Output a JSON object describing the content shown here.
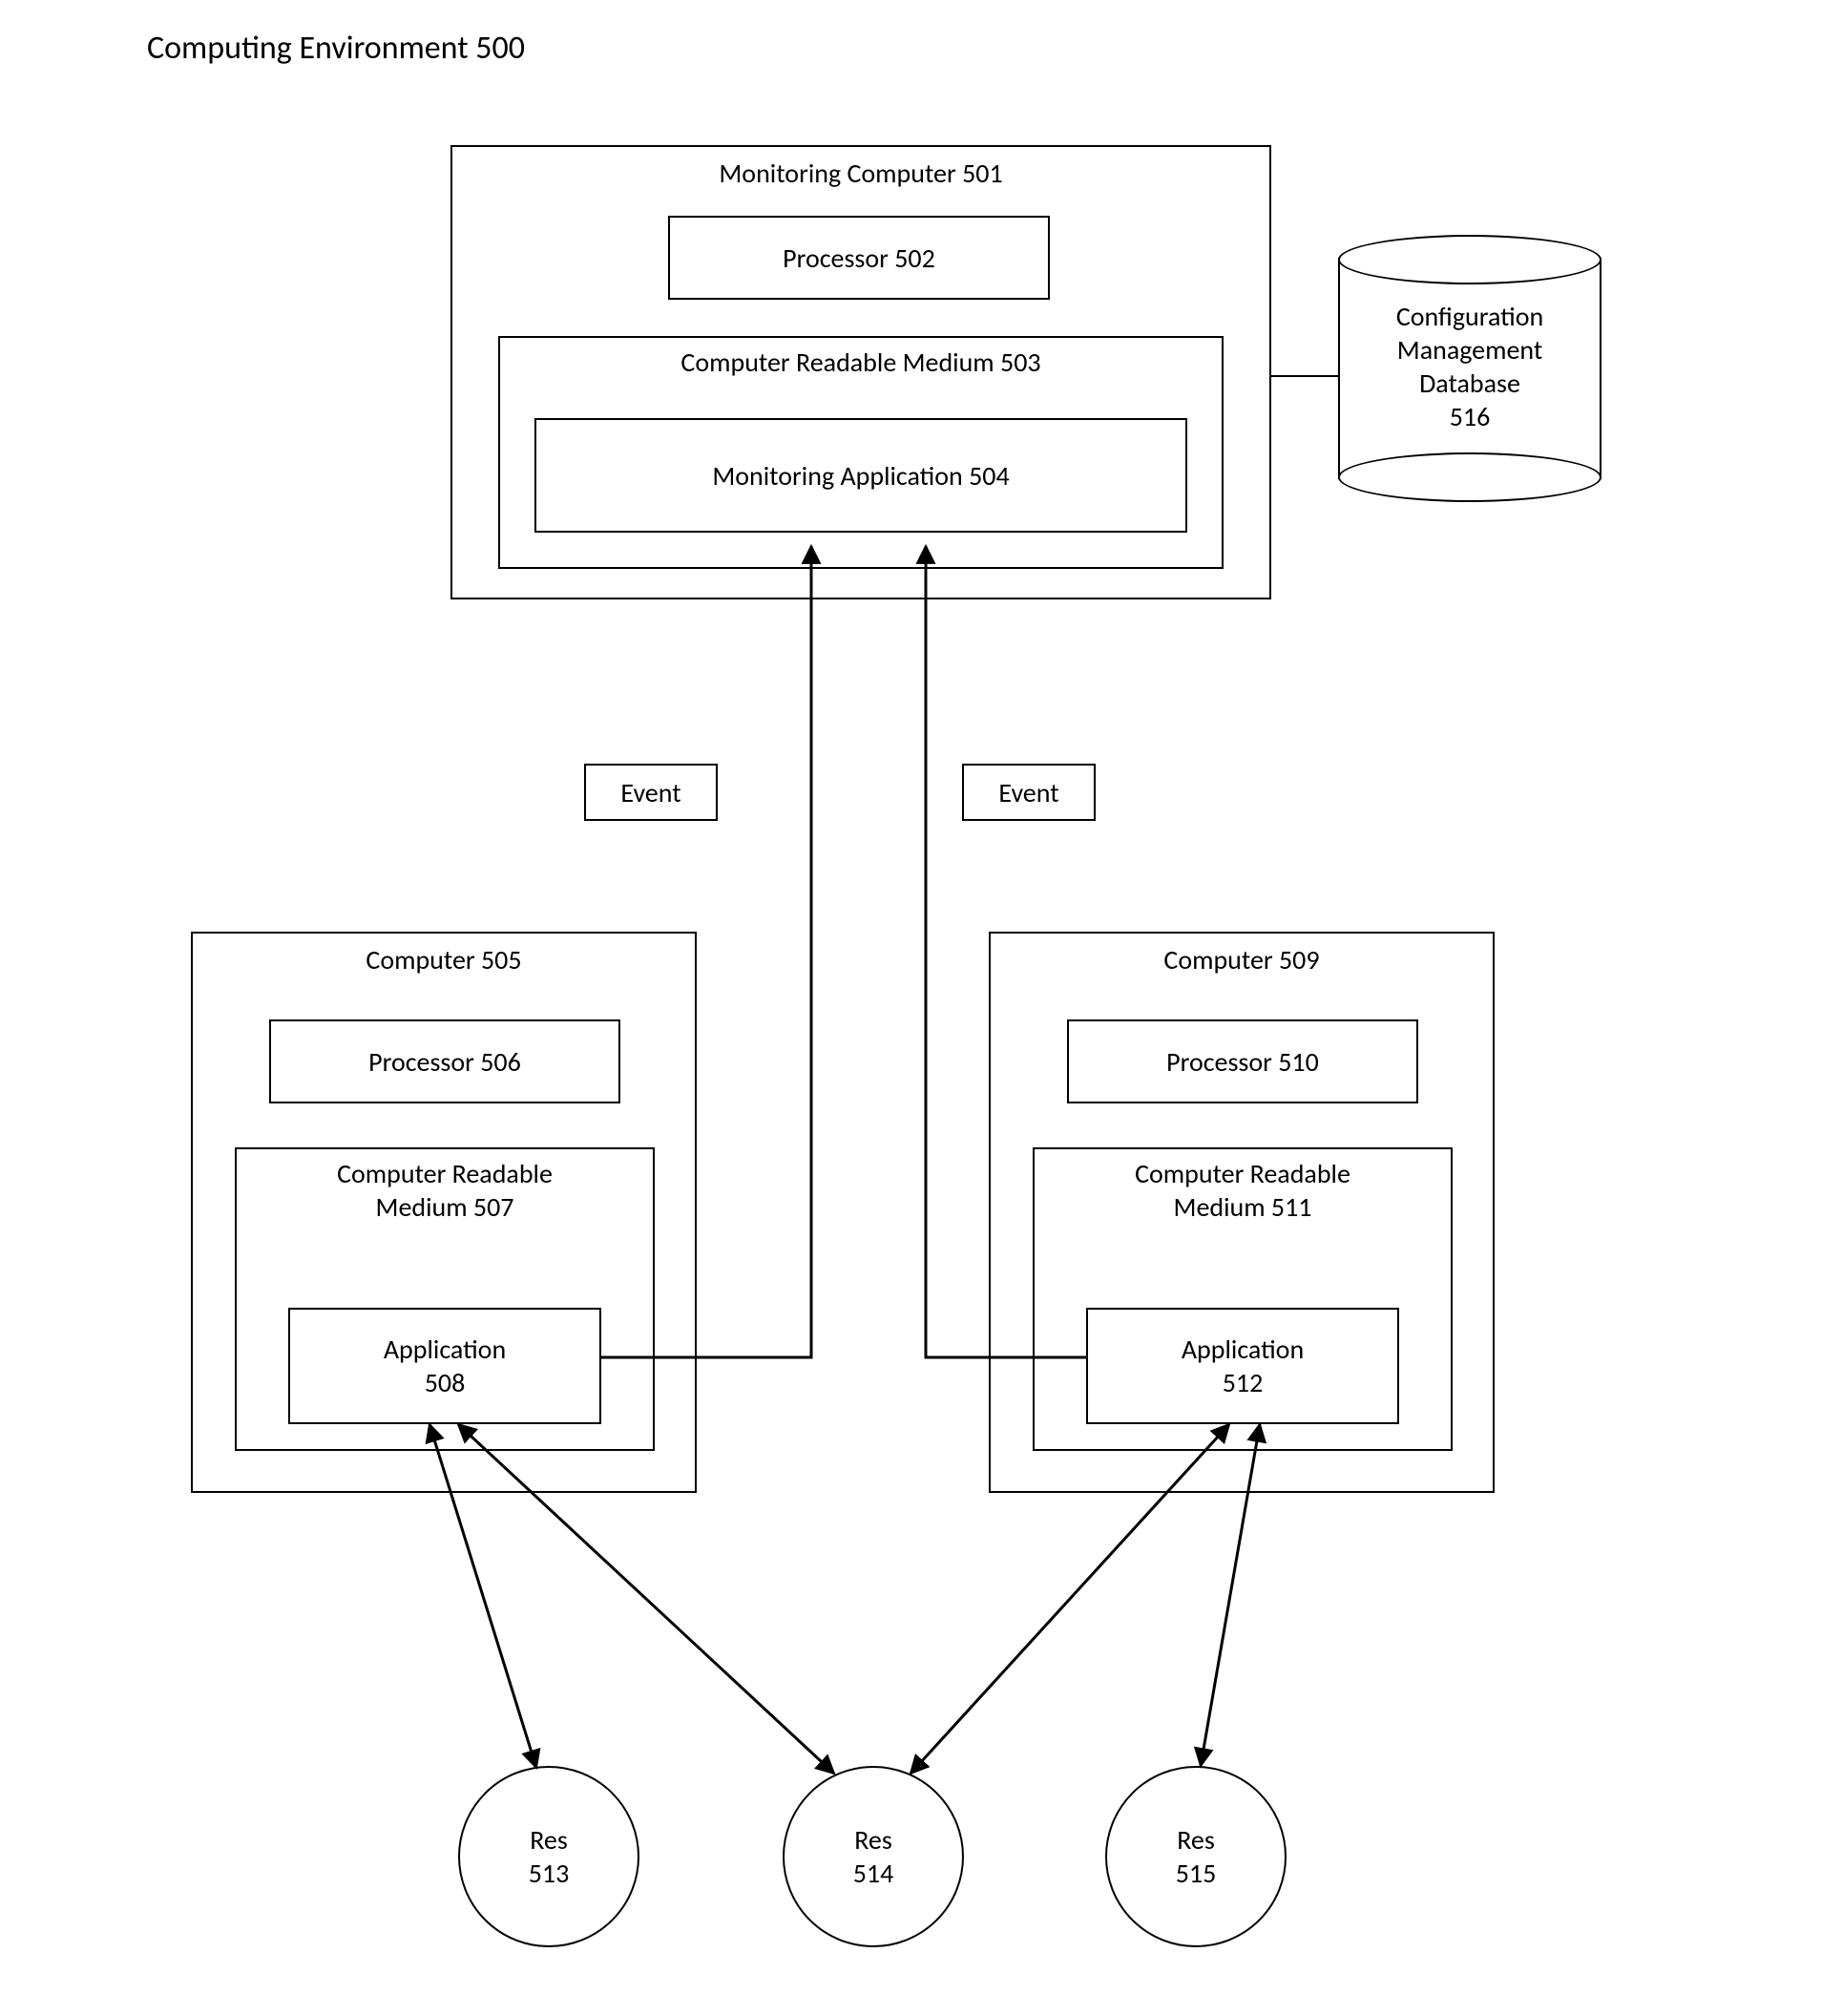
{
  "title": "Computing Environment 500",
  "monitoring_computer": {
    "title": "Monitoring Computer 501",
    "processor": "Processor 502",
    "medium": "Computer Readable Medium 503",
    "application": "Monitoring Application 504"
  },
  "database": {
    "label": "Configuration\nManagement\nDatabase\n516"
  },
  "event_left": "Event",
  "event_right": "Event",
  "computer_left": {
    "title": "Computer 505",
    "processor": "Processor 506",
    "medium": "Computer Readable\nMedium 507",
    "application": "Application\n508"
  },
  "computer_right": {
    "title": "Computer 509",
    "processor": "Processor 510",
    "medium": "Computer Readable\nMedium 511",
    "application": "Application\n512"
  },
  "res_left": "Res\n513",
  "res_middle": "Res\n514",
  "res_right": "Res\n515"
}
